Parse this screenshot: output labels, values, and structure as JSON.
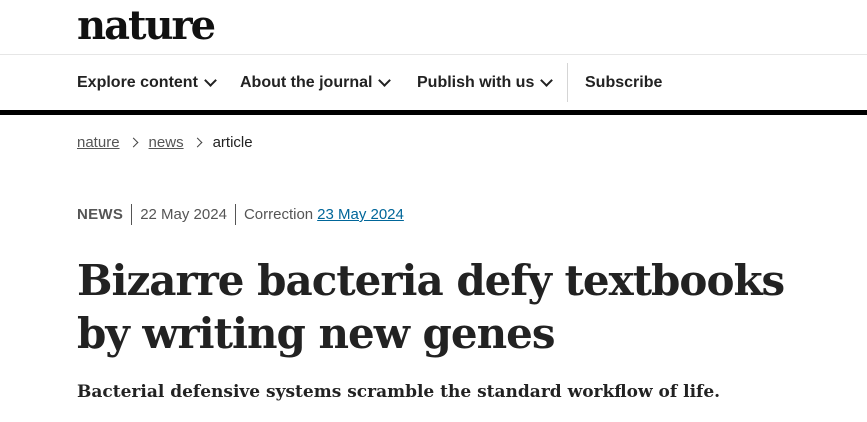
{
  "header": {
    "logo": "nature"
  },
  "nav": {
    "items": [
      {
        "label": "Explore content",
        "has_dropdown": true
      },
      {
        "label": "About the journal",
        "has_dropdown": true
      },
      {
        "label": "Publish with us",
        "has_dropdown": true
      },
      {
        "label": "Subscribe",
        "has_dropdown": false
      }
    ]
  },
  "breadcrumb": {
    "items": [
      "nature",
      "news"
    ],
    "current": "article"
  },
  "meta": {
    "type": "NEWS",
    "published": "22 May 2024",
    "correction_label": "Correction",
    "correction_date": "23 May 2024"
  },
  "article": {
    "title": "Bizarre bacteria defy textbooks by writing new genes",
    "standfirst": "Bacterial defensive systems scramble the standard workflow of life."
  },
  "colors": {
    "link": "#006699",
    "text": "#222222",
    "rule": "#000000"
  }
}
